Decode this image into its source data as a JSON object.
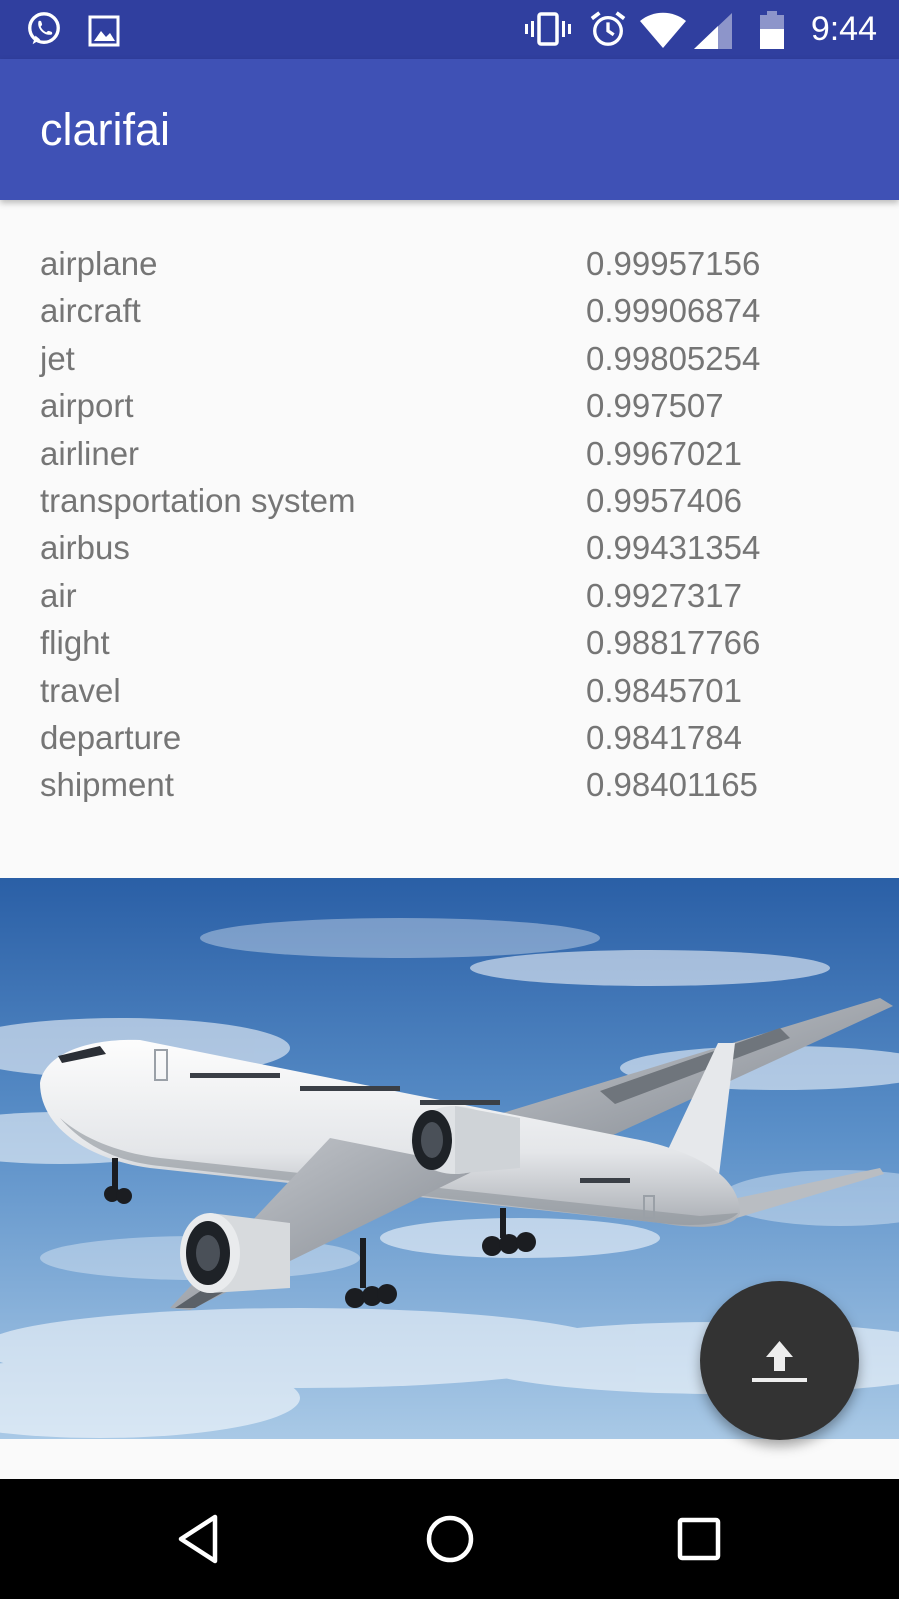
{
  "status_bar": {
    "time": "9:44",
    "left_icons": [
      "whatsapp-icon",
      "gallery-icon"
    ],
    "right_icons": [
      "vibrate-icon",
      "alarm-icon",
      "wifi-icon",
      "signal-icon",
      "battery-icon"
    ],
    "background": "#303f9f"
  },
  "app_bar": {
    "title": "clarifai",
    "background": "#3f51b5"
  },
  "results": [
    {
      "label": "airplane",
      "score": "0.99957156"
    },
    {
      "label": "aircraft",
      "score": "0.99906874"
    },
    {
      "label": "jet",
      "score": "0.99805254"
    },
    {
      "label": "airport",
      "score": "0.997507"
    },
    {
      "label": "airliner",
      "score": "0.9967021"
    },
    {
      "label": "transportation system",
      "score": "0.9957406"
    },
    {
      "label": "airbus",
      "score": "0.99431354"
    },
    {
      "label": "air",
      "score": "0.9927317"
    },
    {
      "label": "flight",
      "score": "0.98817766"
    },
    {
      "label": "travel",
      "score": "0.9845701"
    },
    {
      "label": "departure",
      "score": "0.9841784"
    },
    {
      "label": "shipment",
      "score": "0.98401165"
    }
  ],
  "image": {
    "subject": "airliner-in-sky-photo"
  },
  "fab": {
    "icon": "upload-icon",
    "background": "#333333"
  },
  "nav_bar": {
    "buttons": [
      "back-icon",
      "home-icon",
      "recents-icon"
    ]
  }
}
